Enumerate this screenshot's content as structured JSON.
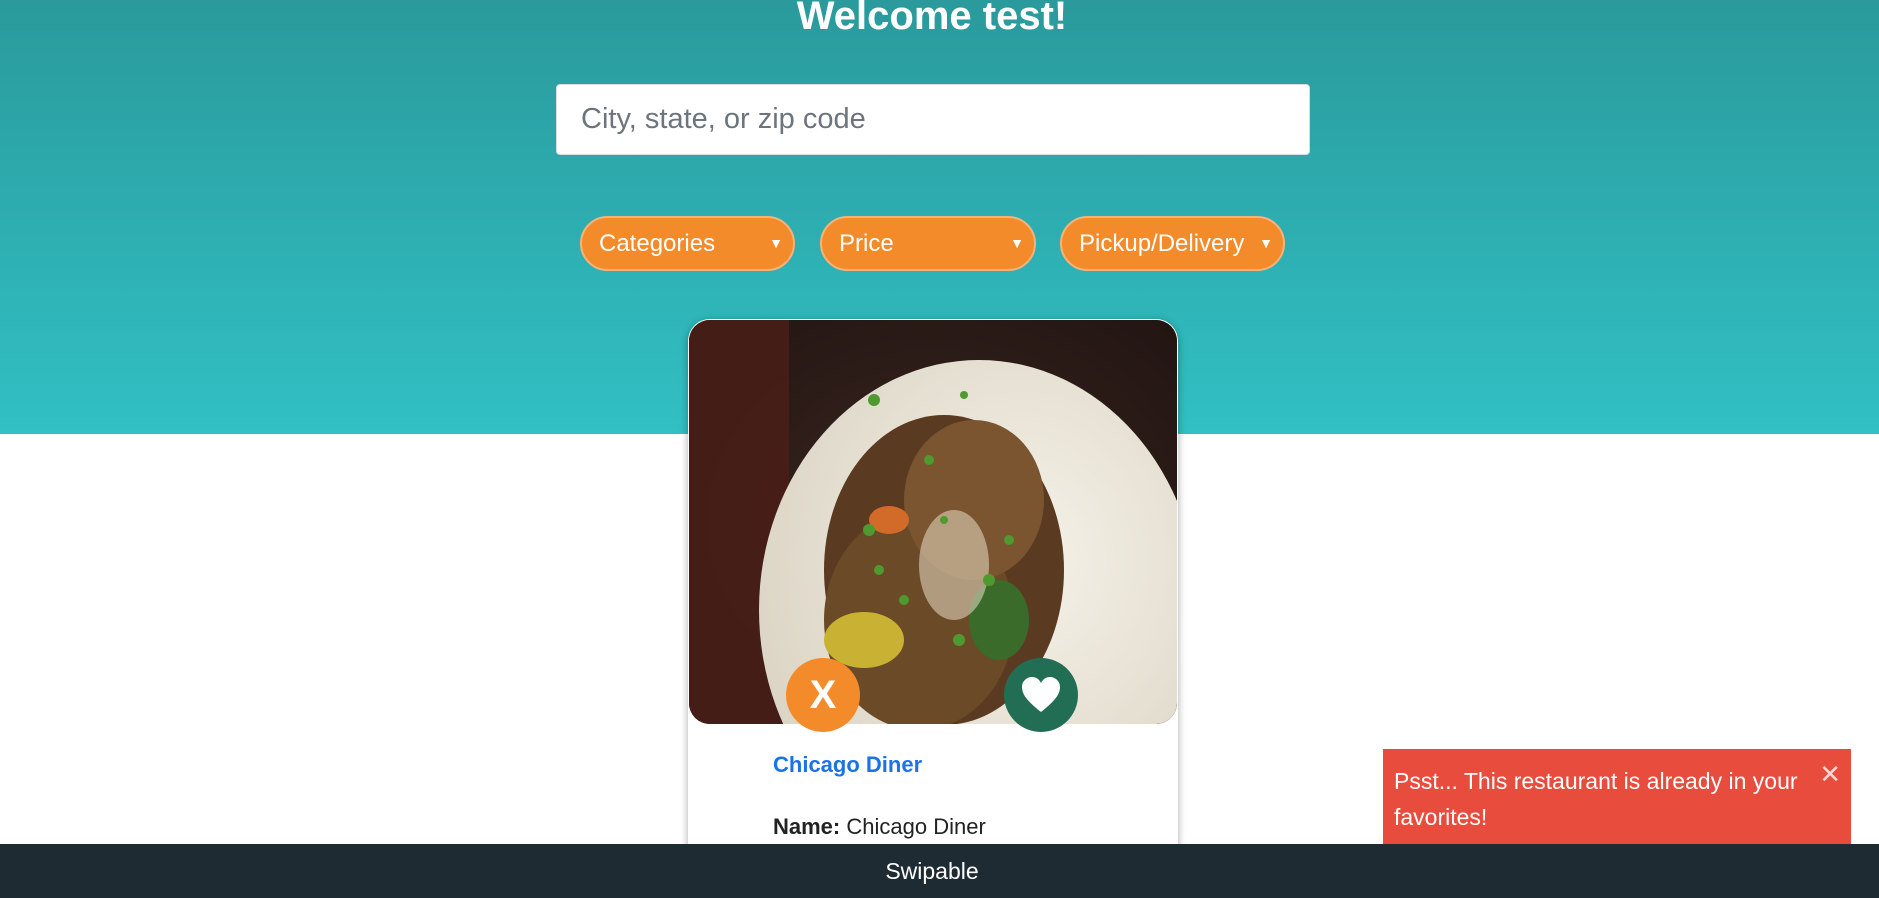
{
  "header": {
    "welcome": "Welcome test!"
  },
  "search": {
    "placeholder": "City, state, or zip code",
    "value": ""
  },
  "filters": {
    "categories": "Categories",
    "price": "Price",
    "delivery": "Pickup/Delivery"
  },
  "card": {
    "photo_description_icon": "food-photo",
    "dislike_label": "X",
    "like_icon": "heart-icon",
    "title": "Chicago Diner",
    "name_label": "Name:",
    "name_value": "Chicago Diner"
  },
  "toast": {
    "message": "Psst... This restaurant is already in your favorites!",
    "close": "✕"
  },
  "footer": {
    "brand": "Swipable"
  },
  "colors": {
    "hero_top": "#2a9a9c",
    "hero_bottom": "#31c0c4",
    "accent_orange": "#f48b2a",
    "like_green": "#226e55",
    "link_blue": "#1a73e8",
    "toast_red": "#e84c3d",
    "footer_dark": "#1f2b33"
  }
}
